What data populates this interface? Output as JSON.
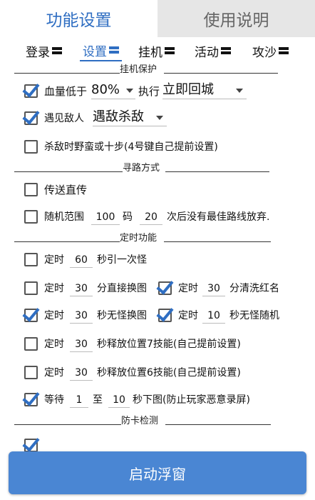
{
  "top_tabs": [
    {
      "label": "功能设置",
      "active": true
    },
    {
      "label": "使用说明",
      "active": false
    }
  ],
  "sub_tabs": [
    "登录",
    "设置",
    "挂机",
    "活动",
    "攻沙"
  ],
  "sections": {
    "hangup_protect": "挂机保护",
    "pathing": "寻路方式",
    "timer": "定时功能",
    "anti_stuck": "防卡检测"
  },
  "hp_low": {
    "checked": true,
    "label": "血量低于",
    "value": "80%",
    "action_label": "执行",
    "action": "立即回城"
  },
  "meet_enemy": {
    "checked": true,
    "label": "遇见敌人",
    "action": "遇敌杀敌"
  },
  "kill_savage": {
    "checked": false,
    "label": "杀敌时野蛮或十步(4号键自己提前设置)"
  },
  "teleport": {
    "checked": false,
    "label": "传送直传"
  },
  "random_range": {
    "checked": false,
    "label": "随机范围",
    "range": "100",
    "unit": "码",
    "times": "20",
    "suffix": "次后没有最佳路线放弃."
  },
  "timer_items": {
    "t1": {
      "checked": false,
      "prefix": "定时",
      "value": "60",
      "suffix": "秒引一次怪"
    },
    "t2a": {
      "checked": false,
      "prefix": "定时",
      "value": "30",
      "suffix": "分直接换图"
    },
    "t2b": {
      "checked": true,
      "prefix": "定时",
      "value": "30",
      "suffix": "分清洗红名"
    },
    "t3a": {
      "checked": true,
      "prefix": "定时",
      "value": "30",
      "suffix": "秒无怪换图"
    },
    "t3b": {
      "checked": true,
      "prefix": "定时",
      "value": "10",
      "suffix": "秒无怪随机"
    },
    "t4": {
      "checked": false,
      "prefix": "定时",
      "value": "30",
      "suffix": "秒释放位置7技能(自己提前设置)"
    },
    "t5": {
      "checked": false,
      "prefix": "定时",
      "value": "30",
      "suffix": "秒释放位置6技能(自己提前设置)"
    },
    "t6": {
      "checked": true,
      "prefix": "等待",
      "from": "1",
      "to_label": "至",
      "to": "10",
      "suffix": "秒下图(防止玩家恶意录屏)"
    }
  },
  "start_button": "启动浮窗",
  "colors": {
    "accent": "#2f6ec2",
    "button": "#4a86d3"
  }
}
